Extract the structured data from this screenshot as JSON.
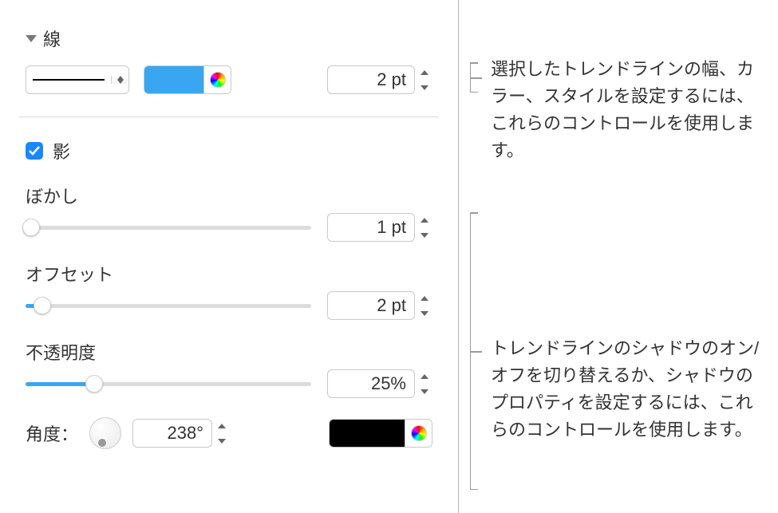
{
  "stroke": {
    "header": "線",
    "width_value": "2 pt",
    "color": "#3aa6f2"
  },
  "shadow": {
    "checkbox_label": "影",
    "checked": true,
    "blur": {
      "label": "ぼかし",
      "value": "1 pt",
      "slider_percent": 2
    },
    "offset": {
      "label": "オフセット",
      "value": "2 pt",
      "slider_percent": 6
    },
    "opacity": {
      "label": "不透明度",
      "value": "25%",
      "slider_percent": 24
    },
    "angle": {
      "label": "角度：",
      "value": "238°"
    }
  },
  "annotations": {
    "stroke": "選択したトレンドラインの幅、カラー、スタイルを設定するには、これらのコントロールを使用します。",
    "shadow": "トレンドラインのシャドウのオン/オフを切り替えるか、シャドウのプロパティを設定するには、これらのコントロールを使用します。"
  }
}
